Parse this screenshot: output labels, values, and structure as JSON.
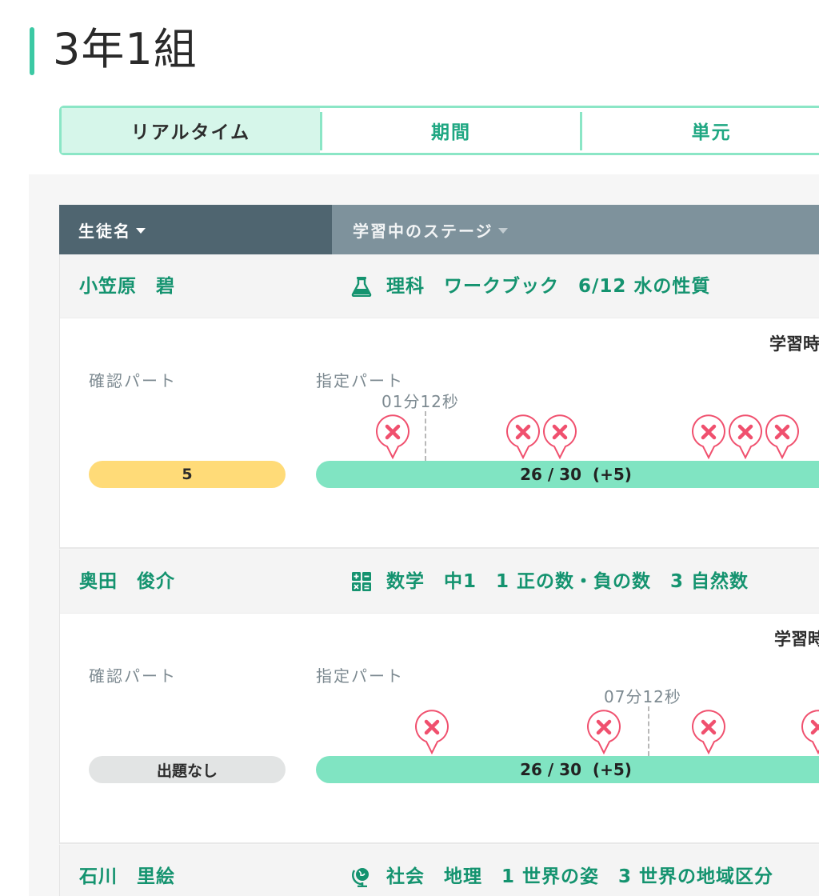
{
  "page": {
    "title": "3年1組"
  },
  "tabs": [
    {
      "label": "リアルタイム",
      "active": true
    },
    {
      "label": "期間",
      "active": false
    },
    {
      "label": "単元",
      "active": false
    }
  ],
  "table": {
    "col_name": "生徒名",
    "col_stage": "学習中のステージ"
  },
  "students": [
    {
      "name": "小笠原　碧",
      "subject_icon": "flask-icon",
      "stage": "理科　ワークブック　6/12 水の性質",
      "study_time_label": "学習時",
      "confirm_label": "確認パート",
      "confirm_value": "5",
      "assigned_label": "指定パート",
      "elapsed": "01分12秒",
      "progress": "26 / 30  (+5)",
      "wrong_marks": 6
    },
    {
      "name": "奥田　俊介",
      "subject_icon": "calculator-icon",
      "stage": "数学　中1　1 正の数・負の数　3 自然数",
      "study_time_label": "学習時",
      "confirm_label": "確認パート",
      "confirm_value": "出題なし",
      "assigned_label": "指定パート",
      "elapsed": "07分12秒",
      "progress": "26 / 30  (+5)",
      "wrong_marks": 4
    },
    {
      "name": "石川　里絵",
      "subject_icon": "globe-icon",
      "stage": "社会　地理　1 世界の姿　3 世界の地域区分"
    }
  ],
  "colors": {
    "accent": "#3cc9a4",
    "progress_fill": "#80e4c2",
    "confirm_yellow": "#ffdb78",
    "confirm_gray": "#e2e4e4",
    "wrong_mark": "#f0506e",
    "header_dark": "#4f6570",
    "header_light": "#7e929c",
    "link_green": "#14936f"
  }
}
